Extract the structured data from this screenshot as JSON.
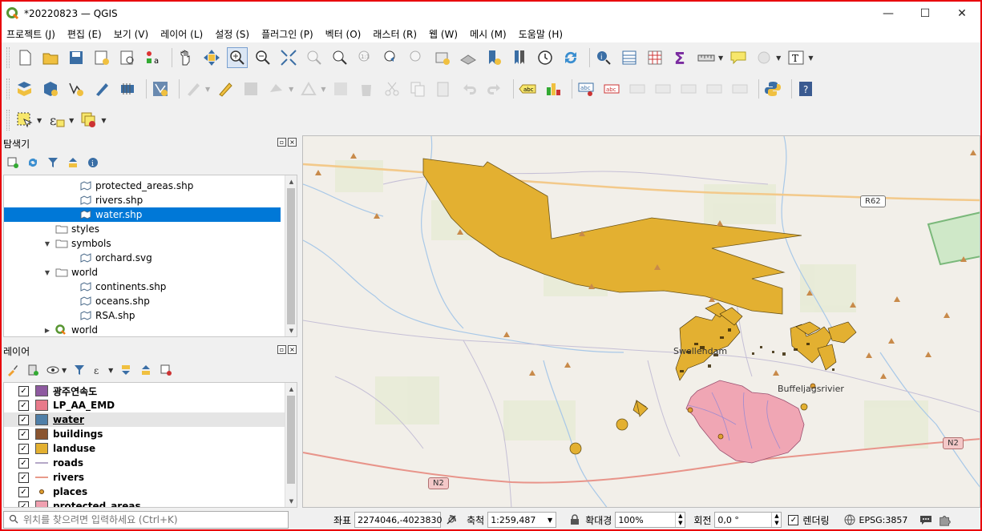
{
  "window": {
    "title": "*20220823 — QGIS",
    "minimize": "—",
    "maximize": "☐",
    "close": "✕"
  },
  "menu": [
    "프로젝트 (J)",
    "편집 (E)",
    "보기 (V)",
    "레이어 (L)",
    "설정 (S)",
    "플러그인 (P)",
    "벡터 (O)",
    "래스터 (R)",
    "웹 (W)",
    "메시 (M)",
    "도움말 (H)"
  ],
  "browser_panel": {
    "title": "탐색기",
    "items": [
      {
        "label": "protected_areas.shp",
        "type": "shp",
        "indent": 2
      },
      {
        "label": "rivers.shp",
        "type": "shp",
        "indent": 2
      },
      {
        "label": "water.shp",
        "type": "shp",
        "indent": 2,
        "selected": true
      },
      {
        "label": "styles",
        "type": "folder",
        "indent": 1
      },
      {
        "label": "symbols",
        "type": "folder",
        "indent": 1,
        "expanded": true
      },
      {
        "label": "orchard.svg",
        "type": "shp",
        "indent": 2
      },
      {
        "label": "world",
        "type": "folder",
        "indent": 1,
        "expanded": true
      },
      {
        "label": "continents.shp",
        "type": "shp",
        "indent": 2
      },
      {
        "label": "oceans.shp",
        "type": "shp",
        "indent": 2
      },
      {
        "label": "RSA.shp",
        "type": "shp",
        "indent": 2
      },
      {
        "label": "world",
        "type": "qgs",
        "indent": 1,
        "collapsed": true
      }
    ]
  },
  "layers_panel": {
    "title": "레이어",
    "layers": [
      {
        "label": "광주연속도",
        "kind": "fill",
        "color": "#8e5aa0"
      },
      {
        "label": "LP_AA_EMD",
        "kind": "fill",
        "color": "#e87a8a"
      },
      {
        "label": "water",
        "kind": "fill",
        "color": "#4f7fa8",
        "active": true
      },
      {
        "label": "buildings",
        "kind": "fill",
        "color": "#8a5530"
      },
      {
        "label": "landuse",
        "kind": "fill",
        "color": "#e3b031"
      },
      {
        "label": "roads",
        "kind": "line",
        "color": "#b5a8c8"
      },
      {
        "label": "rivers",
        "kind": "line",
        "color": "#e89a8a"
      },
      {
        "label": "places",
        "kind": "point",
        "color": "#e0a030"
      },
      {
        "label": "protected_areas",
        "kind": "fill",
        "color": "#f0a0b0"
      }
    ]
  },
  "map": {
    "labels": {
      "town1": "Swellendam",
      "town2": "Buffeljagsrivier",
      "road_r62": "R62",
      "road_n2_a": "N2",
      "road_n2_b": "N2"
    }
  },
  "status": {
    "locator_placeholder": "위치를 찾으려면 입력하세요 (Ctrl+K)",
    "coord_label": "좌표",
    "coord_value": "2274046,-4023830",
    "scale_label": "축척",
    "scale_value": "1:259,487",
    "magnifier_label": "확대경",
    "magnifier_value": "100%",
    "rotation_label": "회전",
    "rotation_value": "0,0 °",
    "render_label": "렌더링",
    "crs": "EPSG:3857"
  }
}
